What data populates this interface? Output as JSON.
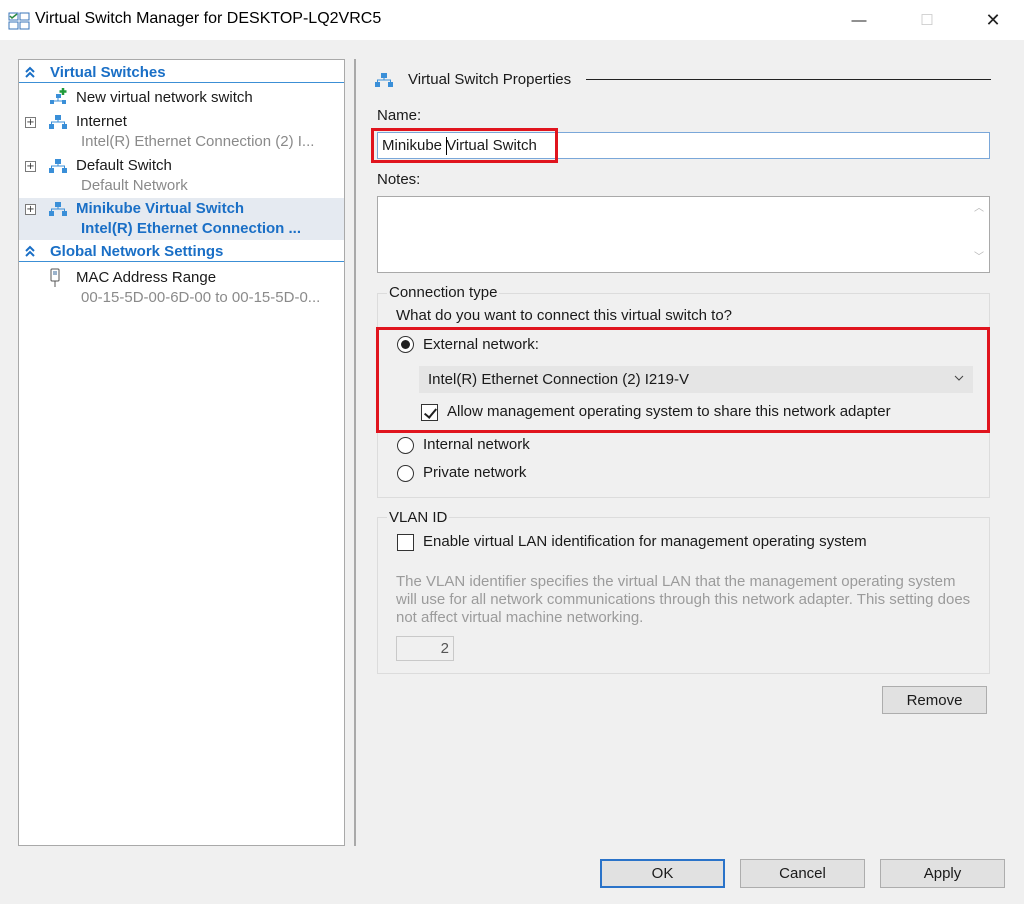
{
  "window": {
    "title": "Virtual Switch Manager for DESKTOP-LQ2VRC5",
    "minimize": "—",
    "maximize": "☐",
    "close": "✕"
  },
  "tree": {
    "virtual_switches_header": "Virtual Switches",
    "new_switch_label": "New virtual network switch",
    "switches": [
      {
        "name": "Internet",
        "adapter": "Intel(R) Ethernet Connection (2) I...",
        "expander": "+"
      },
      {
        "name": "Default Switch",
        "adapter": "Default Network",
        "expander": "+"
      },
      {
        "name": "Minikube Virtual Switch",
        "adapter": "Intel(R) Ethernet Connection ...",
        "expander": "+",
        "selected": true
      }
    ],
    "global_header": "Global Network Settings",
    "mac_range_label": "MAC Address Range",
    "mac_range_value": "00-15-5D-00-6D-00 to 00-15-5D-0..."
  },
  "properties": {
    "header": "Virtual Switch Properties",
    "name_label": "Name:",
    "name_value": "Minikube Virtual Switch",
    "notes_label": "Notes:",
    "notes_value": "",
    "connection_type_title": "Connection type",
    "connection_question": "What do you want to connect this virtual switch to?",
    "external_label": "External network:",
    "external_adapter": "Intel(R) Ethernet Connection (2) I219-V",
    "allow_mgmt_label": "Allow management operating system to share this network adapter",
    "internal_label": "Internal network",
    "private_label": "Private network",
    "selected_connection": "External network",
    "allow_mgmt_checked": true,
    "vlan_title": "VLAN ID",
    "vlan_enable_label": "Enable virtual LAN identification for management operating system",
    "vlan_enabled": false,
    "vlan_description": "The VLAN identifier specifies the virtual LAN that the management operating system will use for all network communications through this network adapter. This setting does not affect virtual machine networking.",
    "vlan_value": "2",
    "remove_label": "Remove"
  },
  "footer": {
    "ok_label": "OK",
    "cancel_label": "Cancel",
    "apply_label": "Apply"
  },
  "colors": {
    "accent_blue": "#1a6fc6",
    "highlight_red": "#e0141e",
    "selected_row_bg": "#e5eaf1"
  }
}
